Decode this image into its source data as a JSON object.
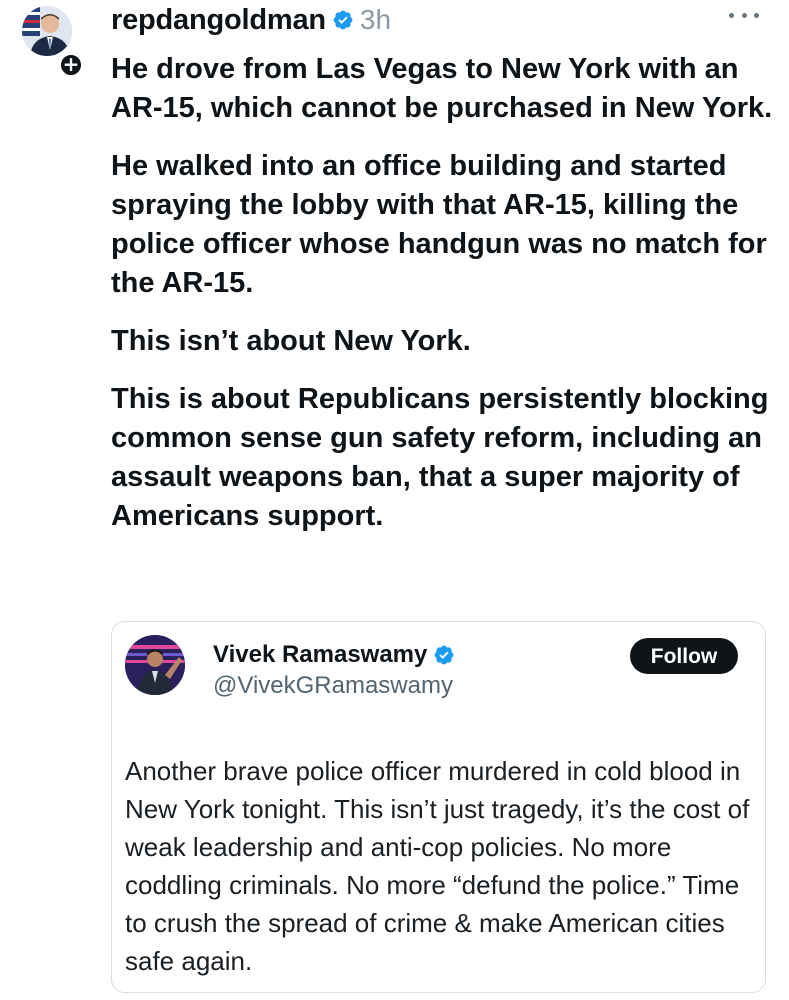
{
  "post": {
    "username": "repdangoldman",
    "time": "3h",
    "paragraphs": [
      "He drove from Las Vegas to New York with an AR-15, which cannot be purchased in New York.",
      "He walked into an office building and started spraying the lobby with that AR-15, killing the police officer whose handgun was no match for the AR-15.",
      "This isn’t about New York.",
      "This is about Republicans persistently blocking common sense gun safety reform, including an assault weapons ban, that a super majority of Americans support."
    ],
    "follow_plus": "+"
  },
  "quote": {
    "name": "Vivek Ramaswamy",
    "handle": "@VivekGRamaswamy",
    "follow_label": "Follow",
    "text": "Another brave police officer murdered in cold blood in New York tonight. This isn’t just tragedy, it’s the cost of weak leadership and anti-cop policies. No more coddling criminals. No more “defund the police.” Time to crush the spread of crime & make American cities safe again."
  },
  "icons": {
    "verified": "verified-badge-icon",
    "more": "more-options-icon",
    "follow_plus": "plus-icon"
  },
  "colors": {
    "verified_blue": "#1d9bf0",
    "text": "#0f1419",
    "muted": "#8b98a5",
    "follow_button": "#0f1419"
  }
}
